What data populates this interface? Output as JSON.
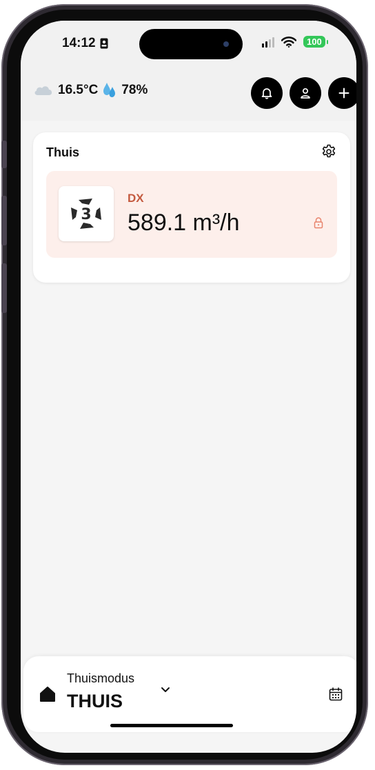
{
  "status_bar": {
    "time": "14:12",
    "battery": "100"
  },
  "header": {
    "temperature": "16.5°C",
    "humidity": "78%",
    "icons": [
      "cloud-icon",
      "droplet-icon",
      "bell-icon",
      "user-icon",
      "plus-icon"
    ]
  },
  "location_card": {
    "title": "Thuis",
    "device": {
      "name": "DX",
      "value": "589.1 m³/h",
      "logo_glyph": "3",
      "accent_color": "#c45a3f",
      "background_color": "#fdefeb"
    }
  },
  "bottom_bar": {
    "mode_label": "Thuismodus",
    "mode_value": "THUIS"
  }
}
